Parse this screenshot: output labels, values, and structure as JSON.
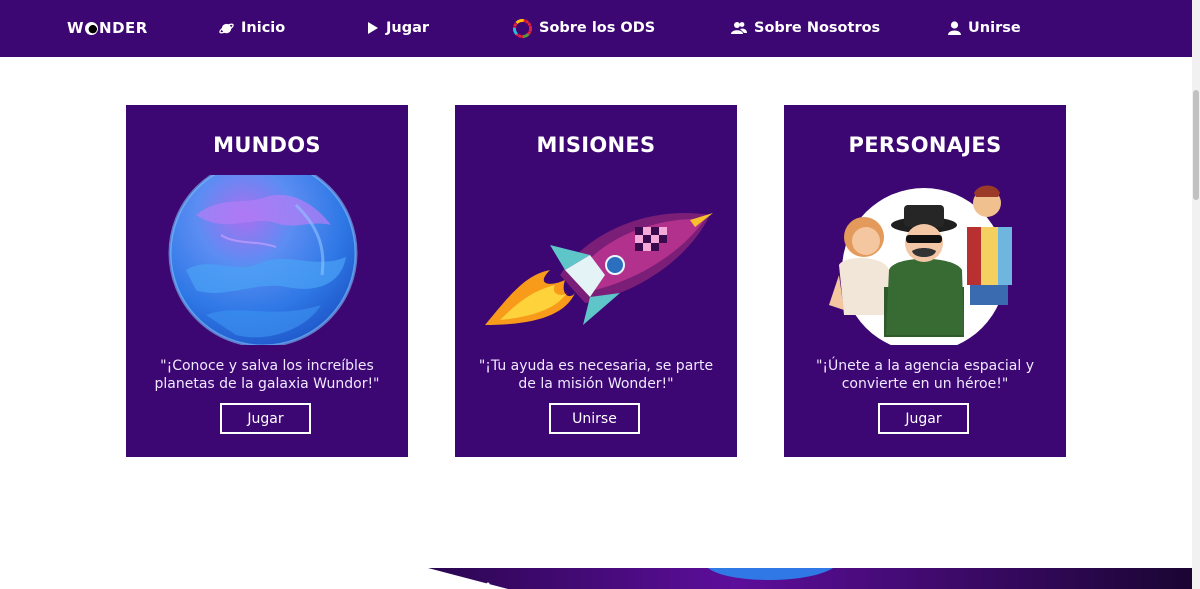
{
  "nav": {
    "logo": "WONDER",
    "logo_parts": {
      "pre": "W",
      "post": "NDER"
    },
    "items": [
      {
        "label": "Inicio",
        "icon": "planet-icon"
      },
      {
        "label": "Jugar",
        "icon": "play-icon"
      },
      {
        "label": "Sobre los ODS",
        "icon": "sdg-wheel-icon"
      },
      {
        "label": "Sobre Nosotros",
        "icon": "users-icon"
      },
      {
        "label": "Unirse",
        "icon": "user-icon"
      }
    ]
  },
  "cards": [
    {
      "title": "MUNDOS",
      "description": "\"¡Conoce y salva los increíbles planetas de la galaxia Wundor!\"",
      "button": "Jugar",
      "art": "blue-planet-illustration"
    },
    {
      "title": "MISIONES",
      "description": "\"¡Tu ayuda es necesaria, se parte de la misión Wonder!\"",
      "button": "Unirse",
      "art": "rocket-illustration"
    },
    {
      "title": "PERSONAJES",
      "description": "\"¡Únete a la agencia espacial y convierte en un héroe!\"",
      "button": "Jugar",
      "art": "characters-illustration"
    }
  ],
  "colors": {
    "brand_purple": "#3c0673",
    "text_white": "#ffffff"
  }
}
